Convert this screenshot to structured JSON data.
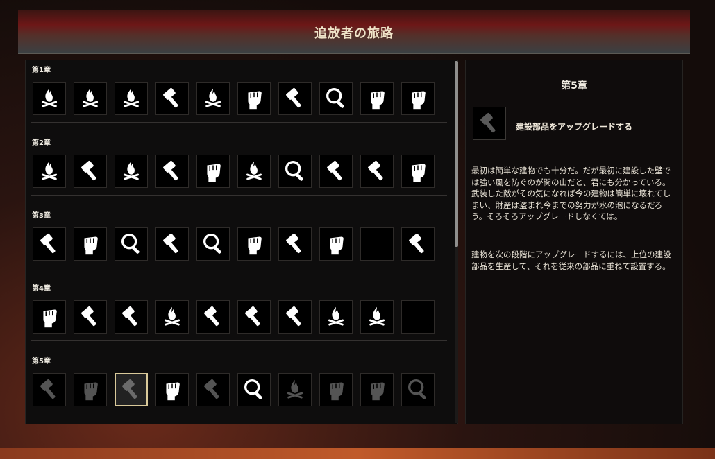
{
  "header": {
    "title": "追放者の旅路"
  },
  "chapters": [
    {
      "title": "第1章",
      "icons": [
        "fire-icon",
        "fire-icon",
        "fire-icon",
        "hammer-icon",
        "fire-icon",
        "fist-icon",
        "hammer-icon",
        "magnifier-icon",
        "fist-icon",
        "fist-icon"
      ],
      "states": [
        "done",
        "done",
        "done",
        "done",
        "done",
        "done",
        "done",
        "done",
        "done",
        "done"
      ]
    },
    {
      "title": "第2章",
      "icons": [
        "fire-icon",
        "hammer-icon",
        "fire-icon",
        "hammer-icon",
        "fist-icon",
        "fire-icon",
        "magnifier-icon",
        "hammer-icon",
        "hammer-icon",
        "fist-icon"
      ],
      "states": [
        "done",
        "done",
        "done",
        "done",
        "done",
        "done",
        "done",
        "done",
        "done",
        "done"
      ]
    },
    {
      "title": "第3章",
      "icons": [
        "hammer-icon",
        "fist-icon",
        "magnifier-icon",
        "hammer-icon",
        "magnifier-icon",
        "fist-icon",
        "hammer-icon",
        "fist-icon",
        "empty",
        "hammer-icon"
      ],
      "states": [
        "done",
        "done",
        "done",
        "done",
        "done",
        "done",
        "done",
        "done",
        "done",
        "done"
      ]
    },
    {
      "title": "第4章",
      "icons": [
        "fist-icon",
        "hammer-icon",
        "hammer-icon",
        "fire-icon",
        "hammer-icon",
        "hammer-icon",
        "hammer-icon",
        "fire-icon",
        "fire-icon",
        "empty"
      ],
      "states": [
        "done",
        "done",
        "done",
        "done",
        "done",
        "done",
        "done",
        "done",
        "done",
        "done"
      ]
    },
    {
      "title": "第5章",
      "icons": [
        "hammer-icon",
        "fist-icon",
        "hammer-icon",
        "fist-icon",
        "hammer-icon",
        "magnifier-icon",
        "fire-icon",
        "fist-icon",
        "fist-icon",
        "magnifier-icon"
      ],
      "states": [
        "dim",
        "dim",
        "selected",
        "done",
        "dim",
        "done",
        "dim",
        "dim",
        "dim",
        "dim"
      ]
    }
  ],
  "detail": {
    "chapter_title": "第5章",
    "icon": "hammer-icon",
    "objective": "建設部品をアップグレードする",
    "paragraph1": "最初は簡単な建物でも十分だ。だが最初に建設した壁では強い風を防ぐのが関の山だと、君にも分かっている。武装した敵がその気になれば今の建物は簡単に壊れてしまい、財産は盗まれ今までの努力が水の泡になるだろう。そろそろアップグレードしなくては。",
    "paragraph2": "建物を次の段階にアップグレードするには、上位の建設部品を生産して、それを従来の部品に重ねて設置する。"
  }
}
